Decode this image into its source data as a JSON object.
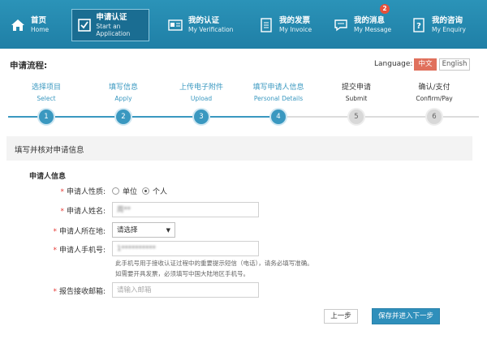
{
  "nav": {
    "items": [
      {
        "cn": "首页",
        "en": "Home"
      },
      {
        "cn": "申请认证",
        "en": "Start an Application"
      },
      {
        "cn": "我的认证",
        "en": "My Verification"
      },
      {
        "cn": "我的发票",
        "en": "My Invoice"
      },
      {
        "cn": "我的消息",
        "en": "My Message",
        "badge": "2"
      },
      {
        "cn": "我的咨询",
        "en": "My Enquiry"
      }
    ]
  },
  "header": {
    "title": "申请流程:",
    "language_label": "Language:",
    "lang_cn": "中文",
    "lang_en": "English"
  },
  "steps": [
    {
      "cn": "选择项目",
      "en": "Select",
      "num": "1",
      "status": "done"
    },
    {
      "cn": "填写信息",
      "en": "Apply",
      "num": "2",
      "status": "done"
    },
    {
      "cn": "上传电子附件",
      "en": "Upload",
      "num": "3",
      "status": "done"
    },
    {
      "cn": "填写申请人信息",
      "en": "Personal Details",
      "num": "4",
      "status": "done"
    },
    {
      "cn": "提交申请",
      "en": "Submit",
      "num": "5",
      "status": "todo"
    },
    {
      "cn": "确认/支付",
      "en": "Confirm/Pay",
      "num": "6",
      "status": "todo"
    }
  ],
  "form": {
    "section_title": "填写并核对申请信息",
    "sub_title": "申请人信息",
    "type_label": "申请人性质:",
    "type_options": [
      "单位",
      "个人"
    ],
    "type_selected": "个人",
    "name_label": "申请人姓名:",
    "name_value": "周**",
    "location_label": "申请人所在地:",
    "location_value": "请选择",
    "phone_label": "申请人手机号:",
    "phone_value": "1**********",
    "phone_hint": "此手机号用于接收认证过程中的重要提示短信（电话），请务必填写准确。如需要开具发票，必须填写中国大陆地区手机号。",
    "email_label": "报告接收邮箱:",
    "email_placeholder": "请输入邮箱"
  },
  "buttons": {
    "prev": "上一步",
    "next": "保存并进入下一步"
  },
  "colors": {
    "nav_bg": "#2287ae",
    "step_done": "#3a98c0",
    "step_todo": "#d8d8d8",
    "lang_active": "#e0705c",
    "primary_button": "#2f8fbb",
    "required_star": "#e53935"
  }
}
